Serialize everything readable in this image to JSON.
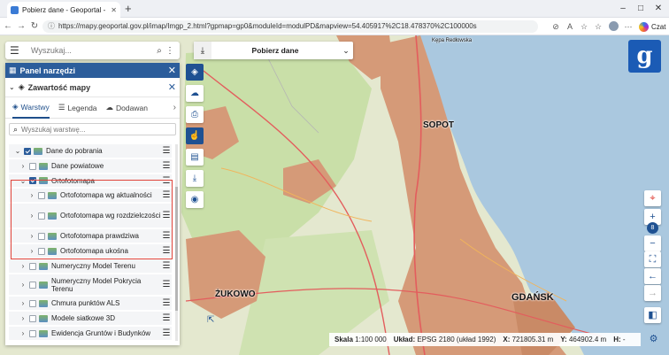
{
  "browser": {
    "tab_title": "Pobierz dane - Geoportal - GUGiK",
    "url": "https://mapy.geoportal.gov.pl/imap/Imgp_2.html?gpmap=gp0&moduleId=modulPD&mapview=54.405917%2C18.478370%2C100000s",
    "copilot_label": "Czat",
    "minimize": "–",
    "maximize": "□",
    "close": "✕",
    "back": "←",
    "forward": "→",
    "reload": "↻"
  },
  "search": {
    "placeholder": "Wyszukaj..."
  },
  "panel": {
    "title": "Panel narzędzi",
    "section_title": "Zawartość mapy",
    "tabs": [
      {
        "label": "Warstwy",
        "active": true
      },
      {
        "label": "Legenda",
        "active": false
      },
      {
        "label": "Dodawan",
        "active": false
      }
    ],
    "layer_search_placeholder": "Wyszukaj warstwę...",
    "layers": [
      {
        "label": "Dane do pobrania",
        "checked": true,
        "indent": 1,
        "expanded": true
      },
      {
        "label": "Dane powiatowe",
        "checked": false,
        "indent": 2,
        "expanded": false
      },
      {
        "label": "Ortofotomapa",
        "checked": true,
        "indent": 2,
        "expanded": true
      },
      {
        "label": "Ortofotomapa wg aktualności",
        "checked": false,
        "indent": 3,
        "expanded": false
      },
      {
        "label": "Ortofotomapa wg rozdzielczości",
        "checked": false,
        "indent": 3,
        "expanded": false
      },
      {
        "label": "Ortofotomapa prawdziwa",
        "checked": false,
        "indent": 3,
        "expanded": false
      },
      {
        "label": "Ortofotomapa ukośna",
        "checked": false,
        "indent": 3,
        "expanded": false
      },
      {
        "label": "Numeryczny Model Terenu",
        "checked": false,
        "indent": 2,
        "expanded": false
      },
      {
        "label": "Numeryczny Model Pokrycia Terenu",
        "checked": false,
        "indent": 2,
        "expanded": false
      },
      {
        "label": "Chmura punktów ALS",
        "checked": false,
        "indent": 2,
        "expanded": false
      },
      {
        "label": "Modele siatkowe 3D",
        "checked": false,
        "indent": 2,
        "expanded": false
      },
      {
        "label": "Ewidencja Gruntów i Budynków",
        "checked": false,
        "indent": 2,
        "expanded": false
      }
    ]
  },
  "layer_selector": {
    "label": "Pobierz dane"
  },
  "map": {
    "labels": {
      "sopot": "SOPOT",
      "gdansk": "GDAŃSK",
      "zukowo": "ŻUKOWO",
      "kepa": "Kępa Redłowska"
    },
    "zoom_level": "8"
  },
  "status": {
    "scale_label": "Skala",
    "scale_value": "1:100 000",
    "system_label": "Układ:",
    "system_value": "EPSG 2180 (układ 1992)",
    "x_label": "X:",
    "x_value": "721805.31 m",
    "y_label": "Y:",
    "y_value": "464902.4 m",
    "h_label": "H:",
    "h_value": "-"
  },
  "colors": {
    "accent": "#2c5d9b",
    "urban": "#d59a78",
    "sea": "#aac8df",
    "forest": "#c5dca4"
  }
}
